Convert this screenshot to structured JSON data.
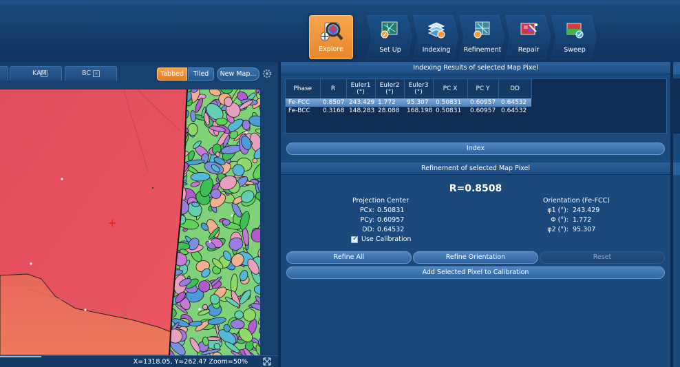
{
  "toolbar": {
    "explore_label": "Explore",
    "steps": [
      {
        "label": "Set Up",
        "icon": "setup-icon"
      },
      {
        "label": "Indexing",
        "icon": "indexing-icon"
      },
      {
        "label": "Refinement",
        "icon": "refinement-icon"
      },
      {
        "label": "Repair",
        "icon": "repair-icon"
      },
      {
        "label": "Sweep",
        "icon": "sweep-icon"
      }
    ]
  },
  "map_panel": {
    "tabs": [
      {
        "label": "KAM"
      },
      {
        "label": "BC"
      }
    ],
    "tabbed_label": "Tabbed",
    "tiled_label": "Tiled",
    "new_map_label": "New Map...",
    "status": "X=1318.05, Y=262.47  Zoom=50%"
  },
  "indexing": {
    "header": "Indexing Results of selected Map Pixel",
    "columns": [
      {
        "line1": "Phase",
        "line2": ""
      },
      {
        "line1": "R",
        "line2": ""
      },
      {
        "line1": "Euler1",
        "line2": "(°)"
      },
      {
        "line1": "Euler2",
        "line2": "(°)"
      },
      {
        "line1": "Euler3",
        "line2": "(°)"
      },
      {
        "line1": "PC X",
        "line2": ""
      },
      {
        "line1": "PC Y",
        "line2": ""
      },
      {
        "line1": "DD",
        "line2": ""
      }
    ],
    "rows": [
      {
        "phase": "Fe-FCC",
        "r": "0.8507",
        "e1": "243.429",
        "e2": "1.772",
        "e3": "95.307",
        "pcx": "0.50831",
        "pcy": "0.60957",
        "dd": "0.64532",
        "selected": true
      },
      {
        "phase": "Fe-BCC",
        "r": "0.3168",
        "e1": "148.283",
        "e2": "28.088",
        "e3": "168.198",
        "pcx": "0.50831",
        "pcy": "0.60957",
        "dd": "0.64532",
        "selected": false
      }
    ],
    "index_button": "Index"
  },
  "refinement": {
    "header": "Refinement of selected Map Pixel",
    "r_value": "R=0.8508",
    "projection_center": {
      "title": "Projection Center",
      "items": [
        {
          "key": "PCx:",
          "value": "0.50831"
        },
        {
          "key": "PCy:",
          "value": "0.60957"
        },
        {
          "key": "DD:",
          "value": "0.64532"
        }
      ]
    },
    "orientation": {
      "title": "Orientation (Fe-FCC)",
      "items": [
        {
          "key": "φ1 (°):",
          "value": "243.429"
        },
        {
          "key": "Φ (°):",
          "value": "1.772"
        },
        {
          "key": "φ2 (°):",
          "value": "95.307"
        }
      ]
    },
    "use_calibration_label": "Use Calibration",
    "use_calibration_checked": true,
    "refine_all": "Refine All",
    "refine_orientation": "Refine Orientation",
    "reset": "Reset",
    "add_to_calibration": "Add Selected Pixel to Calibration"
  },
  "colors": {
    "accent_orange": "#e9862a",
    "panel_blue": "#1b497c",
    "map_red": "#e8525e",
    "map_green": "#5fd35a"
  }
}
